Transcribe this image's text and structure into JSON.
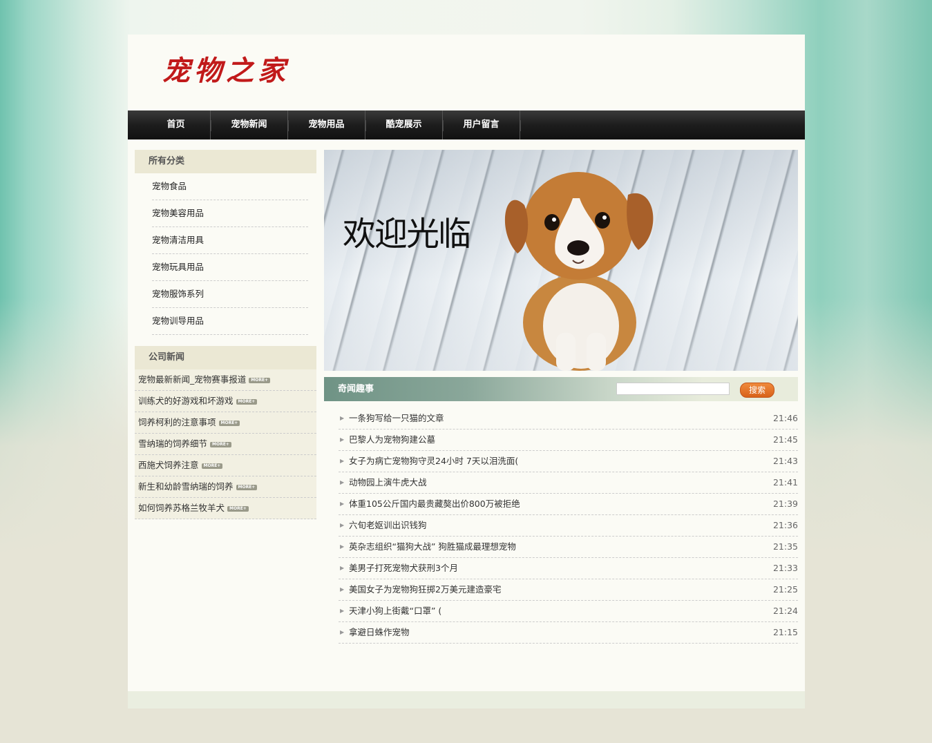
{
  "header": {
    "logo_text": "宠物之家"
  },
  "nav": {
    "items": [
      "首页",
      "宠物新闻",
      "宠物用品",
      "酷宠展示",
      "用户留言"
    ]
  },
  "sidebar": {
    "categories_title": "所有分类",
    "categories": [
      "宠物食品",
      "宠物美容用品",
      "宠物清洁用具",
      "宠物玩具用品",
      "宠物服饰系列",
      "宠物训导用品"
    ],
    "news_title": "公司新闻",
    "more_label": "MORE+",
    "news": [
      "宠物最新新闻_宠物赛事报道",
      "训练犬的好游戏和坏游戏",
      "饲养柯利的注意事项",
      "雪纳瑞的饲养细节",
      "西施犬饲养注意",
      "新生和幼龄雪纳瑞的饲养",
      "如何饲养苏格兰牧羊犬"
    ]
  },
  "banner": {
    "welcome_text": "欢迎光临"
  },
  "main": {
    "section_title": "奇闻趣事",
    "search": {
      "placeholder": "",
      "button_label": "搜索"
    },
    "articles": [
      {
        "title": "一条狗写给一只猫的文章",
        "time": "21:46"
      },
      {
        "title": "巴黎人为宠物狗建公墓",
        "time": "21:45"
      },
      {
        "title": "女子为病亡宠物狗守灵24小时 7天以泪洗面(",
        "time": "21:43"
      },
      {
        "title": "动物园上演牛虎大战",
        "time": "21:41"
      },
      {
        "title": "体重105公斤国内最贵藏獒出价800万被拒绝",
        "time": "21:39"
      },
      {
        "title": "六旬老妪训出识钱狗",
        "time": "21:36"
      },
      {
        "title": "英杂志组织“猫狗大战” 狗胜猫成最理想宠物",
        "time": "21:35"
      },
      {
        "title": "美男子打死宠物犬获刑3个月",
        "time": "21:33"
      },
      {
        "title": "美国女子为宠物狗狂掷2万美元建造豪宅",
        "time": "21:25"
      },
      {
        "title": "天津小狗上街戴“口罩” (",
        "time": "21:24"
      },
      {
        "title": "拿避日蛛作宠物",
        "time": "21:15"
      }
    ]
  },
  "colors": {
    "logo_red": "#c11a1a",
    "nav_dark": "#1d1d1d",
    "search_orange": "#e0702a",
    "sidebar_head": "#ebe8d4"
  }
}
